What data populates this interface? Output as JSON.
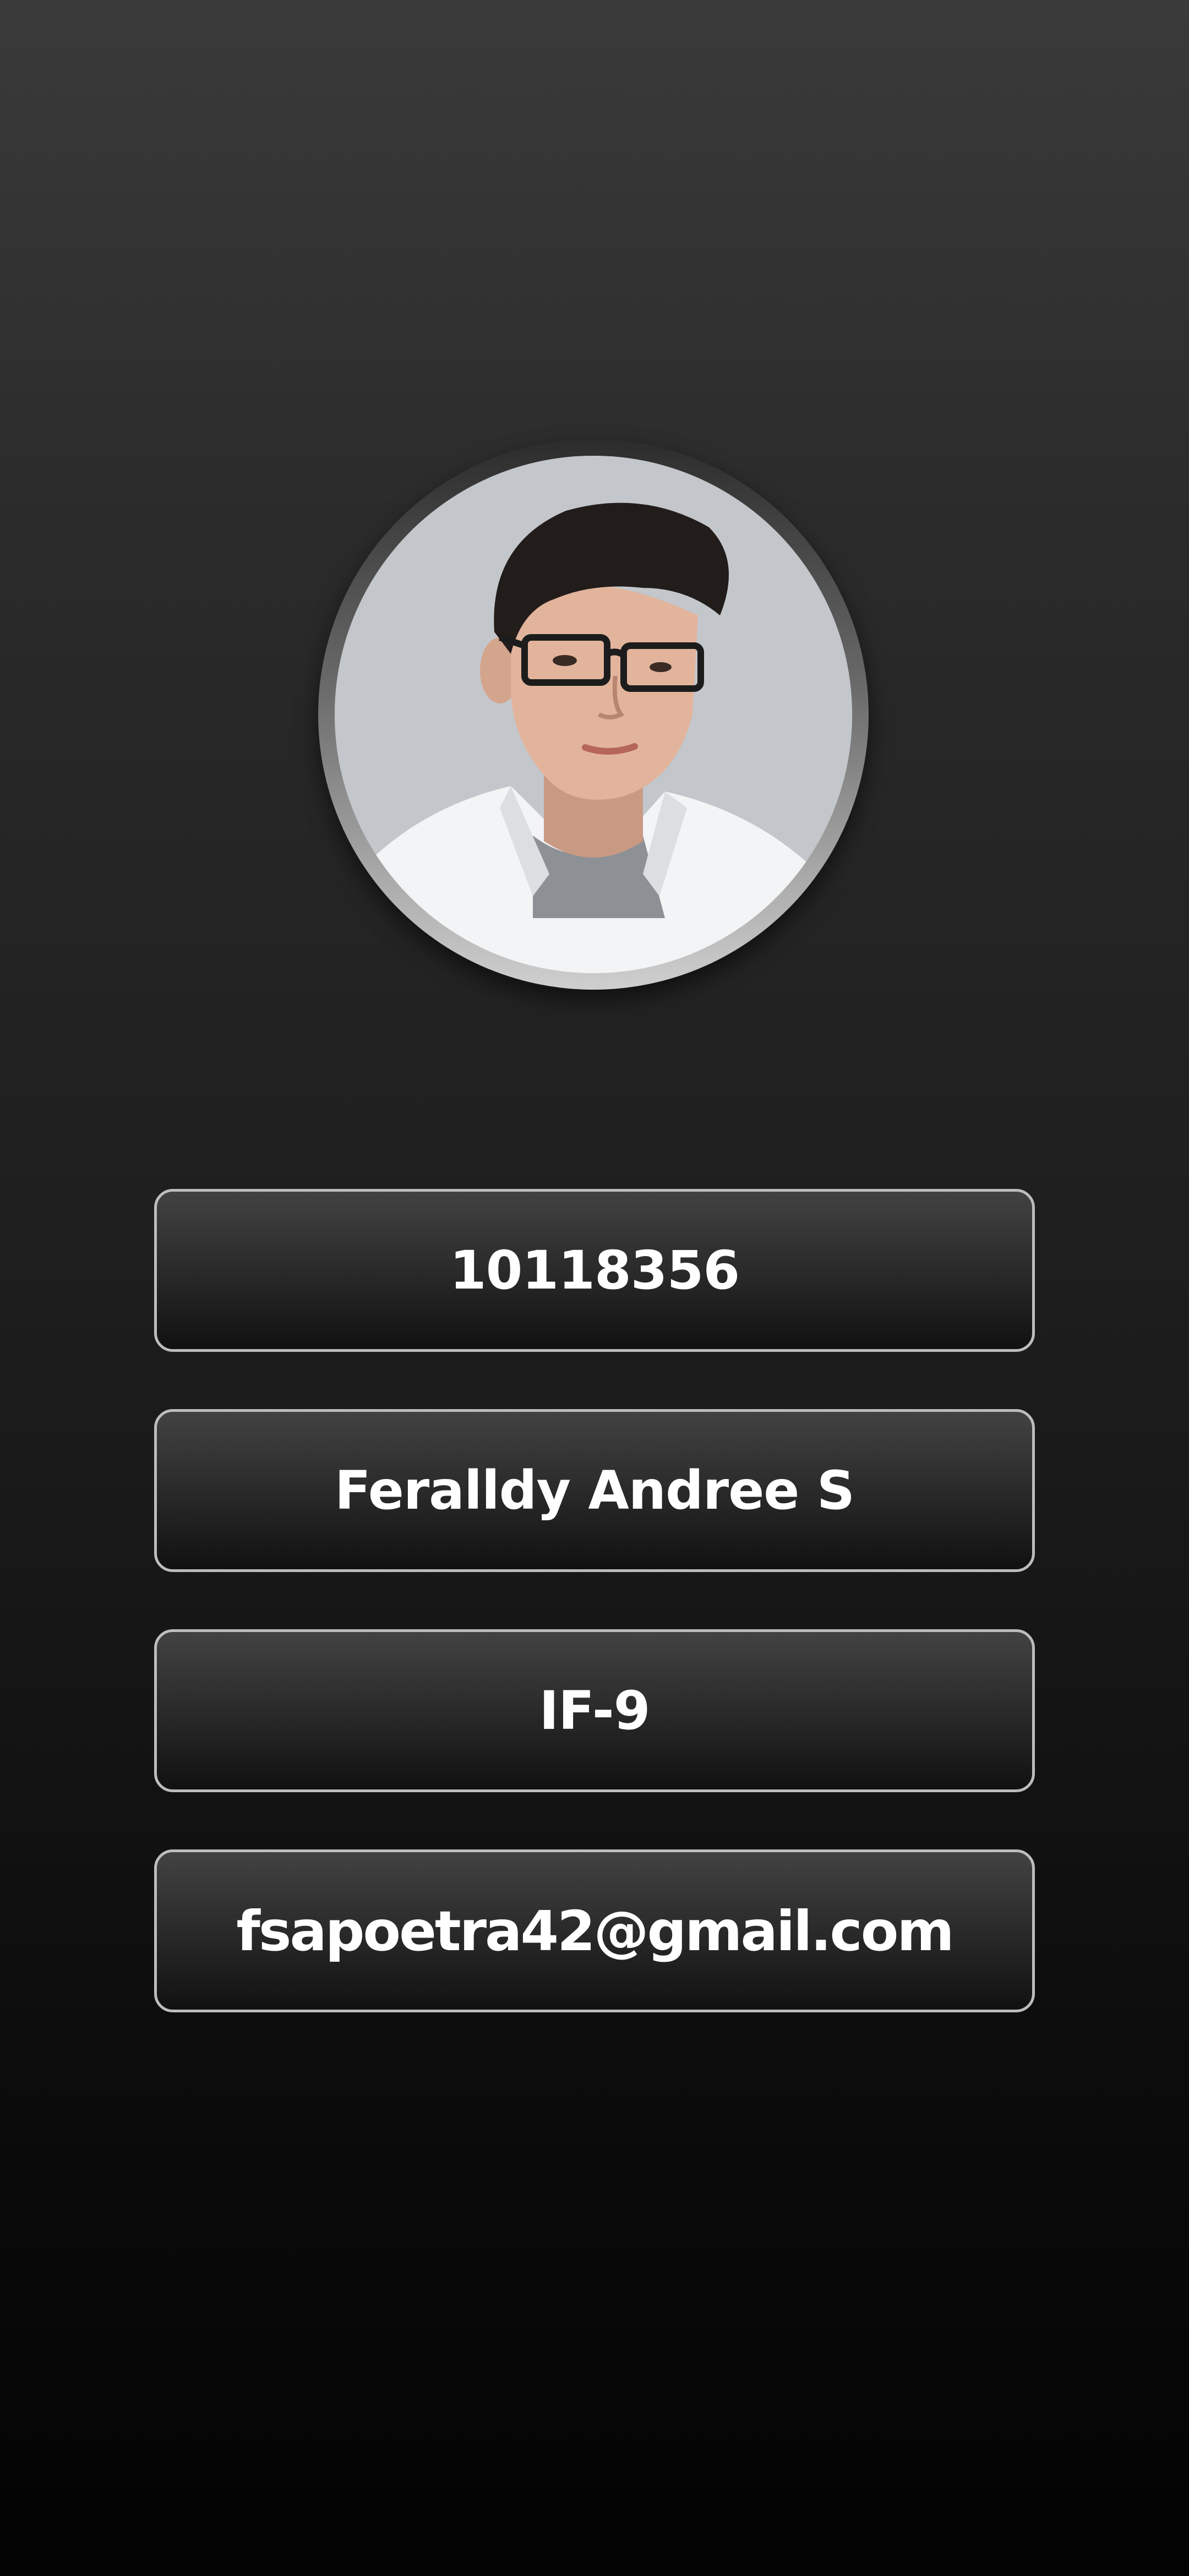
{
  "profile": {
    "avatar_icon": "profile-photo",
    "fields": {
      "student_id": "10118356",
      "full_name": "Feralldy Andree S",
      "class": "IF-9",
      "email": "fsapoetra42@gmail.com"
    }
  },
  "colors": {
    "background_top": "#3a3a3a",
    "background_bottom": "#030303",
    "box_border": "#bdbdbd",
    "text": "#ffffff"
  }
}
